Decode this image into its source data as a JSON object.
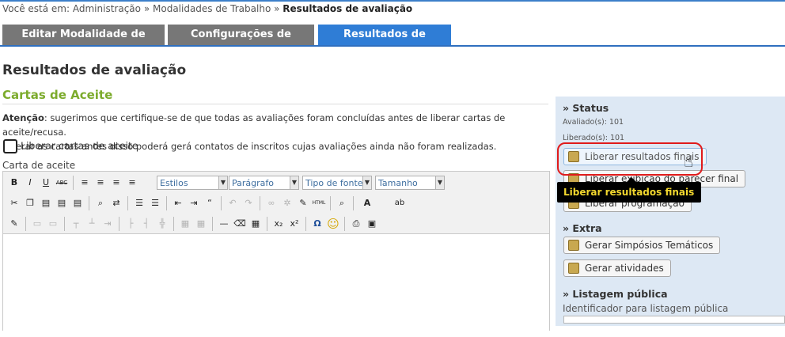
{
  "breadcrumb": {
    "prefix": "Você está em:",
    "items": [
      "Administração",
      "Modalidades de Trabalho",
      "Resultados de avaliação"
    ],
    "separator": "»"
  },
  "tabs": [
    {
      "label": "Editar Modalidade de Trabalho",
      "active": false
    },
    {
      "label": "Configurações de avaliação",
      "active": false
    },
    {
      "label": "Resultados de avaliação",
      "active": true
    }
  ],
  "page": {
    "title": "Resultados de avaliação",
    "section_title": "Cartas de Aceite",
    "warning_label": "Atenção",
    "warning_text": ": sugerimos que certifique-se de que todas as avaliações foram concluídas antes de liberar cartas de aceite/recusa.",
    "warning_text2": "Liberar as cartas antes disso poderá gerá contatos de inscritos cujas avaliações ainda não foram realizadas.",
    "checkbox_label": "Liberar cartas de aceite",
    "checkbox_checked": false,
    "field_label": "Carta de aceite"
  },
  "editor": {
    "styles_placeholder": "Estilos",
    "format_placeholder": "Parágrafo",
    "font_placeholder": "Tipo de fonte",
    "size_placeholder": "Tamanho",
    "buttons": {
      "bold": "B",
      "italic": "I",
      "underline": "U",
      "strike": "ABC",
      "omega": "Ω",
      "html": "HTML",
      "sub": "x₂",
      "sup": "x²",
      "smile": "☺",
      "text_color": "A",
      "bg_color": "ab"
    }
  },
  "sidebar": {
    "status_title": "» Status",
    "evaluated": "Avaliado(s): 101",
    "released": "Liberado(s): 101",
    "btn_release_final": "Liberar resultados finais",
    "btn_release_opinion": "Liberar exibição do parecer final",
    "btn_release_schedule": "Liberar programação",
    "extra_title": "» Extra",
    "btn_symposia": "Gerar Simpósios Temáticos",
    "btn_activities": "Gerar atividades",
    "public_title": "» Listagem pública",
    "public_identifier_label": "Identificador para listagem pública",
    "tooltip": "Liberar resultados finais"
  },
  "colors": {
    "accent_blue": "#2f7dd6",
    "tab_grey": "#777777",
    "section_green": "#7cab2c",
    "sidebar_bg": "#dde8f4",
    "highlight_red": "#e01b1b",
    "tooltip_text": "#f2d72e"
  }
}
